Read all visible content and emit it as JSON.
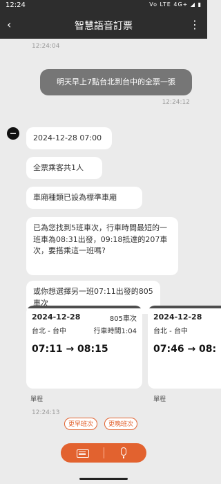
{
  "status_bar": {
    "time": "12:24",
    "icons": "Vo LTE 4G+ ◢ ▮"
  },
  "app_bar": {
    "title": "智慧語音訂票",
    "back_icon": "back-arrow-icon",
    "more_icon": "more-vert-icon"
  },
  "chat": {
    "timestamps": {
      "top": "12:24:04",
      "user": "12:24:12",
      "bottom": "12:24:13"
    },
    "user_message": "明天早上7點台北到台中的全票一張",
    "bot_messages": [
      "2024-12-28 07:00",
      "全票乘客共1人",
      "車廂種類已設為標準車廂",
      "已為您找到5班車次，行車時間最短的一班車為08:31出發，09:18抵達的207車次，要搭乘這一班嗎?",
      "或你想選擇另一班07:11出發的805車次"
    ],
    "cards": [
      {
        "date": "2024-12-28",
        "train": "805車次",
        "route": "台北 - 台中",
        "duration": "行車時間1:04",
        "times": "07:11 → 08:15",
        "caption": "單程"
      },
      {
        "date": "2024-12-28",
        "train": "",
        "route": "台北 - 台中",
        "duration": "",
        "times": "07:46 → 08:",
        "caption": "單程"
      }
    ],
    "chips": {
      "earlier": "更早班次",
      "later": "更晚班次"
    }
  },
  "bottom_bar": {
    "keyboard_icon": "keyboard-icon",
    "mic_icon": "microphone-icon"
  },
  "colors": {
    "accent": "#e2622f",
    "dark": "#2d2d2d",
    "user_bubble": "#767676",
    "background": "#ebebeb"
  }
}
